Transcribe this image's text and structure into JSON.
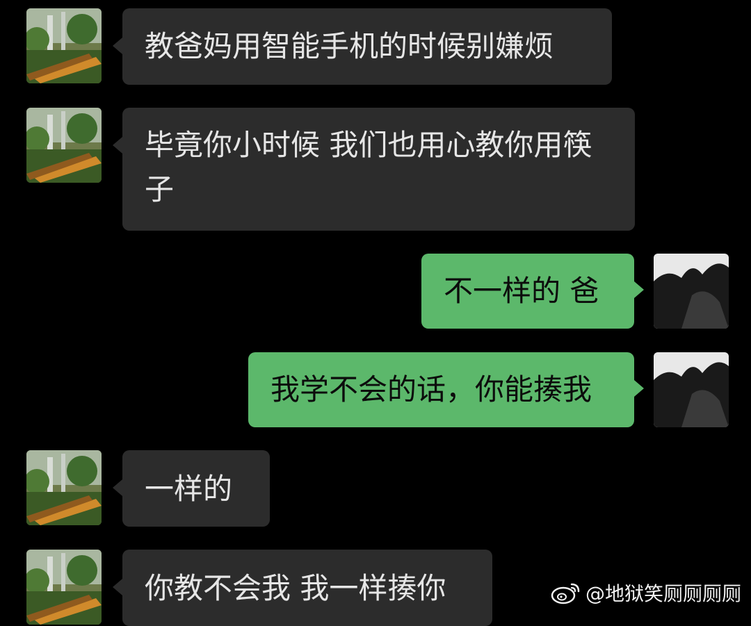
{
  "conversation": {
    "messages": [
      {
        "side": "in",
        "text": "教爸妈用智能手机的时候别嫌烦"
      },
      {
        "side": "in",
        "text": "毕竟你小时候 我们也用心教你用筷子"
      },
      {
        "side": "out",
        "text": "不一样的 爸"
      },
      {
        "side": "out",
        "text": "我学不会的话，你能揍我"
      },
      {
        "side": "in",
        "text": "一样的"
      },
      {
        "side": "in",
        "text": "你教不会我 我一样揍你"
      }
    ]
  },
  "watermark": {
    "text": "@地狱笑厕厕厕厕",
    "icon": "weibo-logo"
  },
  "colors": {
    "background": "#000000",
    "incoming_bubble": "#2c2c2c",
    "outgoing_bubble": "#5cb86b"
  }
}
